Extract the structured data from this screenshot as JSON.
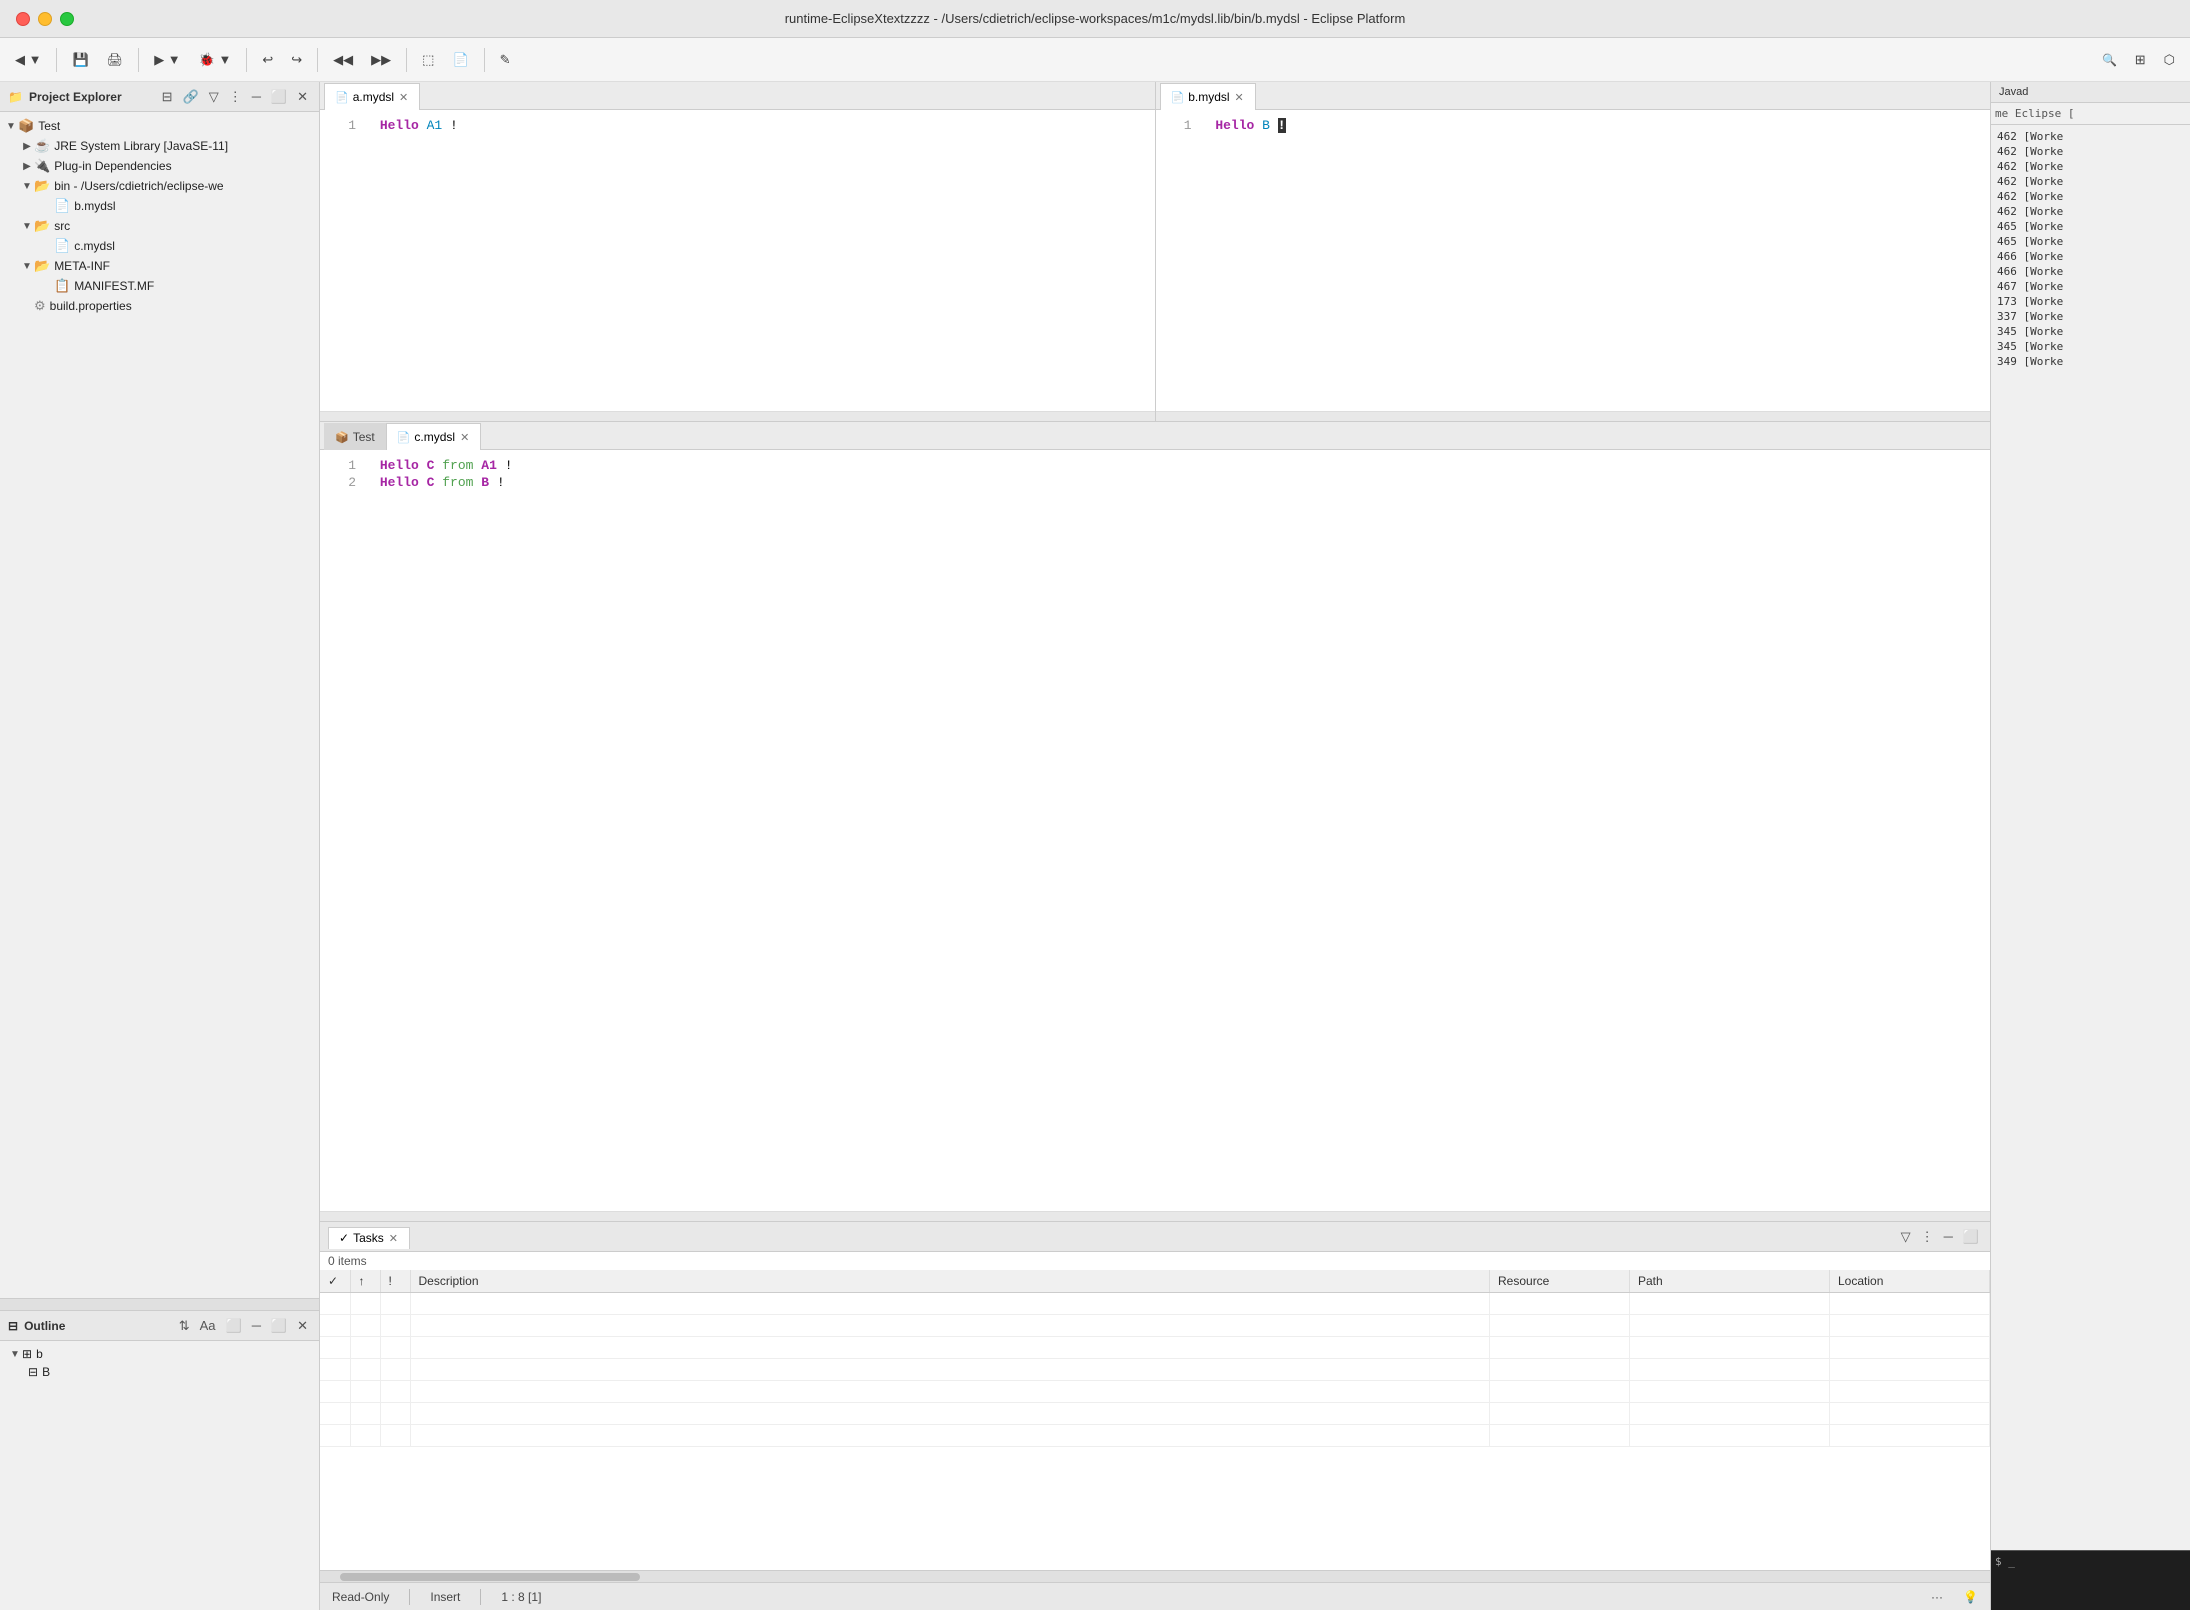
{
  "titleBar": {
    "title": "runtime-EclipseXtextzzzz - /Users/cdietrich/eclipse-workspaces/m1c/mydsl.lib/bin/b.mydsl - Eclipse Platform"
  },
  "toolbar": {
    "searchTooltip": "Search",
    "buttons": [
      "◀",
      "▼",
      "⬛",
      "✎",
      "↩",
      "↪",
      "◀▶",
      "▶◀",
      "⬚"
    ]
  },
  "projectExplorer": {
    "title": "Project Explorer",
    "items": [
      {
        "label": "Test",
        "type": "project",
        "indent": 0,
        "expanded": true
      },
      {
        "label": "JRE System Library [JavaSE-11]",
        "type": "jar",
        "indent": 1,
        "expanded": false
      },
      {
        "label": "Plug-in Dependencies",
        "type": "folder",
        "indent": 1,
        "expanded": false
      },
      {
        "label": "bin - /Users/cdietrich/eclipse-we",
        "type": "folder",
        "indent": 1,
        "expanded": true
      },
      {
        "label": "b.mydsl",
        "type": "file",
        "indent": 2,
        "expanded": false
      },
      {
        "label": "src",
        "type": "folder",
        "indent": 1,
        "expanded": true
      },
      {
        "label": "c.mydsl",
        "type": "file",
        "indent": 2,
        "expanded": false
      },
      {
        "label": "META-INF",
        "type": "folder",
        "indent": 1,
        "expanded": true
      },
      {
        "label": "MANIFEST.MF",
        "type": "manifest",
        "indent": 2,
        "expanded": false
      },
      {
        "label": "build.properties",
        "type": "props",
        "indent": 1,
        "expanded": false
      }
    ]
  },
  "outline": {
    "title": "Outline",
    "items": [
      {
        "label": "b",
        "type": "container",
        "indent": 0,
        "expanded": true
      },
      {
        "label": "B",
        "type": "class",
        "indent": 1,
        "expanded": false
      }
    ]
  },
  "editors": {
    "topLeft": {
      "tabLabel": "a.mydsl",
      "lines": [
        {
          "num": "1",
          "content": "Hello A1!"
        }
      ]
    },
    "topRight": {
      "tabLabel": "b.mydsl",
      "lines": [
        {
          "num": "1",
          "content": "Hello B!"
        }
      ]
    },
    "middle": {
      "tabs": [
        {
          "label": "Test",
          "icon": "project"
        },
        {
          "label": "c.mydsl",
          "icon": "file",
          "active": true
        }
      ],
      "lines": [
        {
          "num": "1",
          "content_kw": "Hello C ",
          "content_kw2": "from",
          "content_rest": " A1!"
        },
        {
          "num": "2",
          "content_kw": "Hello C ",
          "content_kw2": "from",
          "content_rest": " B!"
        }
      ]
    }
  },
  "tasksPanel": {
    "title": "Tasks",
    "itemCount": "0 items",
    "columns": [
      "",
      "",
      "!",
      "Description",
      "Resource",
      "Path",
      "Location"
    ],
    "rows": []
  },
  "statusBar": {
    "readOnly": "Read-Only",
    "insertMode": "Insert",
    "position": "1 : 8 [1]"
  },
  "rightPanel": {
    "tabLabel": "Javad",
    "logLines": [
      {
        "num": "462",
        "text": "[Worke"
      },
      {
        "num": "462",
        "text": "[Worke"
      },
      {
        "num": "462",
        "text": "[Worke"
      },
      {
        "num": "462",
        "text": "[Worke"
      },
      {
        "num": "462",
        "text": "[Worke"
      },
      {
        "num": "462",
        "text": "[Worke"
      },
      {
        "num": "465",
        "text": "[Worke"
      },
      {
        "num": "465",
        "text": "[Worke"
      },
      {
        "num": "466",
        "text": "[Worke"
      },
      {
        "num": "466",
        "text": "[Worke"
      },
      {
        "num": "467",
        "text": "[Worke"
      },
      {
        "num": "173",
        "text": "[Worke"
      },
      {
        "num": "337",
        "text": "[Worke"
      },
      {
        "num": "345",
        "text": "[Worke"
      },
      {
        "num": "345",
        "text": "[Worke"
      },
      {
        "num": "349",
        "text": "[Worke"
      }
    ],
    "headerLabel": "me Eclipse ["
  }
}
